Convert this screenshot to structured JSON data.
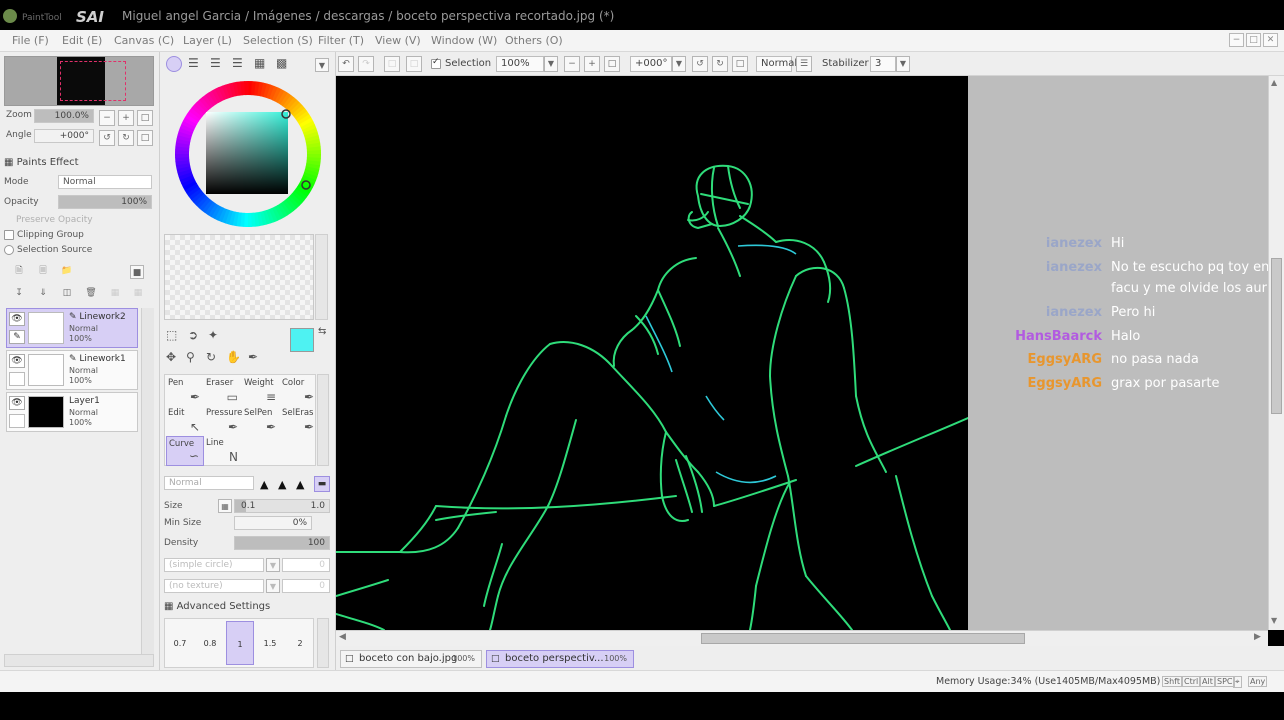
{
  "window": {
    "logo_text": "PaintTool SAI",
    "title": "Miguel angel Garcia / Imágenes / descargas / boceto perspectiva recortado.jpg (*)"
  },
  "menu": [
    "File (F)",
    "Edit (E)",
    "Canvas (C)",
    "Layer (L)",
    "Selection (S)",
    "Filter (T)",
    "View (V)",
    "Window (W)",
    "Others (O)"
  ],
  "navigator": {
    "zoom_label": "Zoom",
    "zoom_value": "100.0%",
    "angle_label": "Angle",
    "angle_value": "+000°"
  },
  "paints_effect": {
    "header": "Paints Effect",
    "mode_label": "Mode",
    "mode_value": "Normal",
    "opacity_label": "Opacity",
    "opacity_value": "100%",
    "preserve_opacity": "Preserve Opacity",
    "clipping_group": "Clipping Group",
    "selection_source": "Selection Source"
  },
  "layers": [
    {
      "name": "Linework2",
      "mode": "Normal",
      "opacity": "100%"
    },
    {
      "name": "Linework1",
      "mode": "Normal",
      "opacity": "100%"
    },
    {
      "name": "Layer1",
      "mode": "Normal",
      "opacity": "100%"
    }
  ],
  "tools": [
    {
      "label": "Pen",
      "icon": "pen-icon"
    },
    {
      "label": "Eraser",
      "icon": "eraser-icon"
    },
    {
      "label": "Weight",
      "icon": "weight-icon"
    },
    {
      "label": "Color",
      "icon": "color-icon"
    },
    {
      "label": "Edit",
      "icon": "edit-icon"
    },
    {
      "label": "Pressure",
      "icon": "pressure-icon"
    },
    {
      "label": "SelPen",
      "icon": "selpen-icon"
    },
    {
      "label": "SelEras",
      "icon": "seleras-icon"
    },
    {
      "label": "Curve",
      "icon": "curve-icon"
    },
    {
      "label": "Line",
      "icon": "line-icon"
    }
  ],
  "brush": {
    "mode_value": "Normal",
    "size_label": "Size",
    "size_min": "0.1",
    "size_value": "1.0",
    "min_size_label": "Min Size",
    "min_size_value": "0%",
    "density_label": "Density",
    "density_value": "100",
    "shape_value": "(simple circle)",
    "texture_value": "(no texture)",
    "advanced": "Advanced Settings",
    "presets": [
      "0.7",
      "0.8",
      "1",
      "1.5",
      "2"
    ]
  },
  "canvas_toolbar": {
    "selection_label": "Selection",
    "zoom": "100%",
    "angle": "+000°",
    "blend": "Normal",
    "stabilizer_label": "Stabilizer",
    "stabilizer_value": "3"
  },
  "chat": [
    {
      "user": "ianezex",
      "message": "Hi",
      "color": "#9aa6c8"
    },
    {
      "user": "ianezex",
      "message": "No te escucho pq toy en la",
      "color": "#9aa6c8"
    },
    {
      "user": "",
      "message": "facu y me olvide los auris",
      "color": "#9aa6c8"
    },
    {
      "user": "ianezex",
      "message": "Pero hi",
      "color": "#9aa6c8"
    },
    {
      "user": "HansBaarck",
      "message": "Halo",
      "color": "#b25be0"
    },
    {
      "user": "EggsyARG",
      "message": "no pasa nada",
      "color": "#e8962e"
    },
    {
      "user": "EggsyARG",
      "message": "grax por pasarte",
      "color": "#e8962e"
    }
  ],
  "tabs": [
    {
      "name": "boceto con bajo.jpg",
      "zoom": "100%"
    },
    {
      "name": "boceto perspectiv...",
      "zoom": "100%"
    }
  ],
  "status": {
    "memory": "Memory Usage:34% (Use1405MB/Max4095MB)",
    "keys": [
      "Shft",
      "Ctrl",
      "Alt",
      "SPC",
      "⌖",
      "Any"
    ]
  },
  "colors": {
    "accent_selected": "#d7cff5",
    "current_color": "#4ef2f2",
    "line_green": "#2fdc7a",
    "line_cyan": "#2ec9d8"
  }
}
